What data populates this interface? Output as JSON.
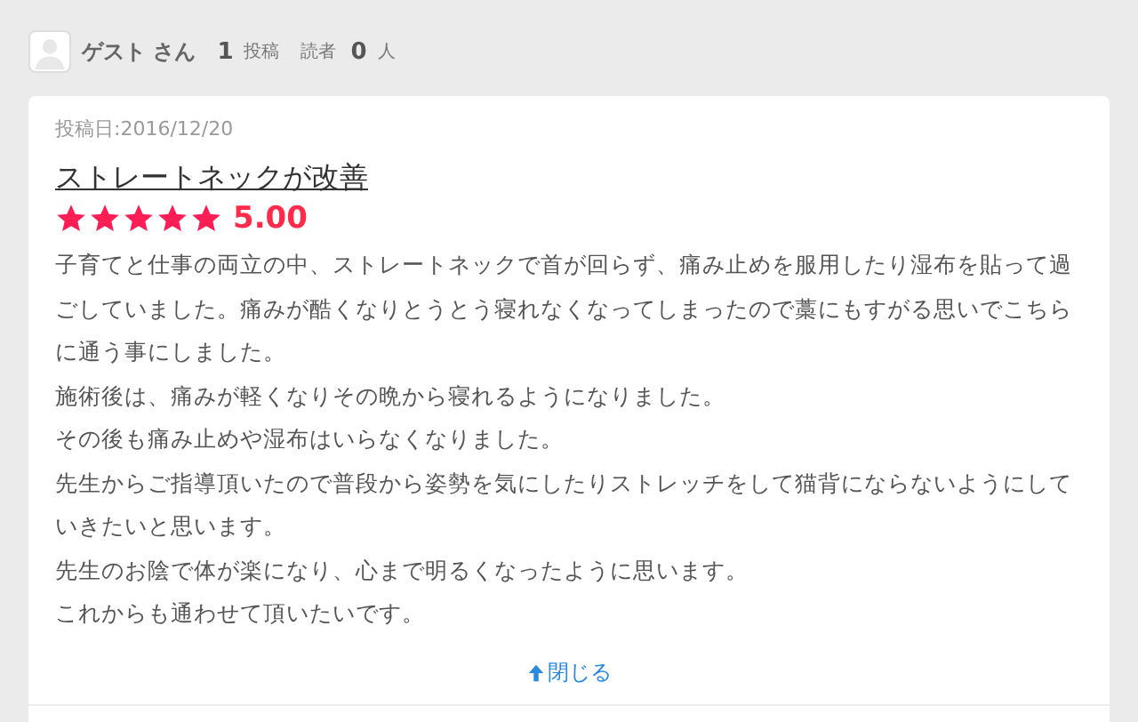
{
  "author": {
    "name": "ゲスト さん",
    "post_count": "1",
    "post_label": "投稿",
    "readers_label": "読者",
    "reader_count": "0",
    "reader_unit": "人"
  },
  "post": {
    "date": "投稿日:2016/12/20",
    "title": "ストレートネックが改善",
    "stars": 5,
    "rating": "5.00",
    "paragraphs": [
      "子育てと仕事の両立の中、ストレートネックで首が回らず、痛み止めを服用したり湿布を貼って過ごしていました。痛みが酷くなりとうとう寝れなくなってしまったので藁にもすがる思いでこちらに通う事にしました。",
      "施術後は、痛みが軽くなりその晩から寝れるようになりました。",
      "その後も痛み止めや湿布はいらなくなりました。",
      "先生からご指導頂いたので普段から姿勢を気にしたりストレッチをして猫背にならないようにしていきたいと思います。",
      "先生のお陰で体が楽になり、心まで明るくなったように思います。",
      "これからも通わせて頂いたいです。"
    ],
    "close_label": "閉じる"
  }
}
